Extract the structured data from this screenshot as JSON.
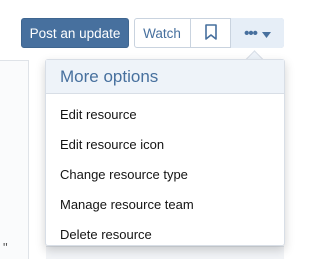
{
  "toolbar": {
    "post_update_label": "Post an update",
    "watch_label": "Watch",
    "bookmark_icon": "bookmark-icon",
    "more_icon": "more-options-icon",
    "more_dots": "•••"
  },
  "menu": {
    "title": "More options",
    "items": [
      {
        "label": "Edit resource"
      },
      {
        "label": "Edit resource icon"
      },
      {
        "label": "Change resource type"
      },
      {
        "label": "Manage resource team"
      },
      {
        "label": "Delete resource"
      }
    ]
  },
  "background": {
    "quote_char": "\""
  },
  "colors": {
    "accent": "#47709e",
    "menu_header_bg": "#eef3f9",
    "border": "#d8dee6"
  }
}
